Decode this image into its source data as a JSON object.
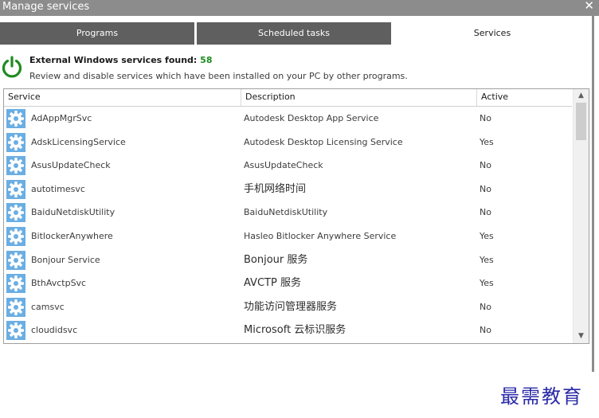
{
  "window": {
    "title": "Manage services",
    "close_glyph": "✕"
  },
  "tabs": [
    {
      "label": "Programs",
      "active": false
    },
    {
      "label": "Scheduled tasks",
      "active": false
    },
    {
      "label": "Services",
      "active": true
    }
  ],
  "header": {
    "found_label": "External Windows services found:",
    "found_count": "58",
    "description": "Review and disable services which have been installed on your PC by other programs.",
    "icon": "power-icon",
    "icon_color": "#1e8c1e"
  },
  "table": {
    "columns": {
      "service": "Service",
      "description": "Description",
      "active": "Active"
    },
    "row_icon": "gear-icon",
    "rows": [
      {
        "service": "AdAppMgrSvc",
        "description": "Autodesk Desktop App Service",
        "active": "No"
      },
      {
        "service": "AdskLicensingService",
        "description": "Autodesk Desktop Licensing Service",
        "active": "Yes"
      },
      {
        "service": "AsusUpdateCheck",
        "description": "AsusUpdateCheck",
        "active": "No"
      },
      {
        "service": "autotimesvc",
        "description": "手机网络时间",
        "active": "No"
      },
      {
        "service": "BaiduNetdiskUtility",
        "description": "BaiduNetdiskUtility",
        "active": "No"
      },
      {
        "service": "BitlockerAnywhere",
        "description": "Hasleo Bitlocker Anywhere Service",
        "active": "Yes"
      },
      {
        "service": "Bonjour Service",
        "description": "Bonjour 服务",
        "active": "Yes"
      },
      {
        "service": "BthAvctpSvc",
        "description": "AVCTP 服务",
        "active": "Yes"
      },
      {
        "service": "camsvc",
        "description": "功能访问管理器服务",
        "active": "No"
      },
      {
        "service": "cloudidsvc",
        "description": "Microsoft 云标识服务",
        "active": "No"
      }
    ]
  },
  "watermark": "最需教育"
}
